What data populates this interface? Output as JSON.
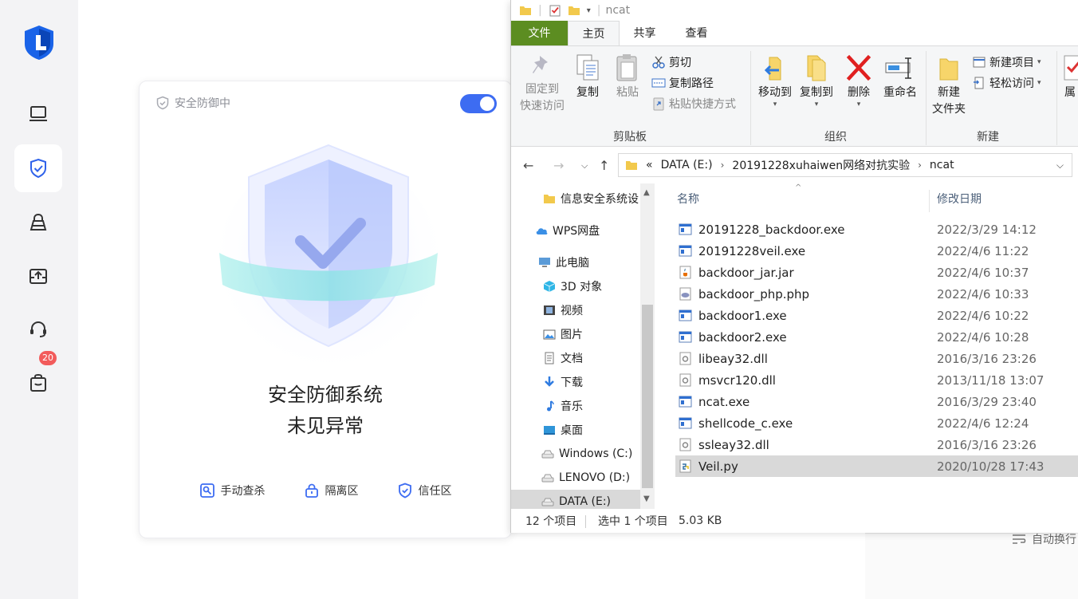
{
  "security_app": {
    "sidebar_badge": "20",
    "status_label": "安全防御中",
    "toggle_on": true,
    "title_line1": "安全防御系统",
    "title_line2": "未见异常",
    "actions": [
      "手动查杀",
      "隔离区",
      "信任区"
    ],
    "icons": [
      "logo-icon",
      "laptop-icon",
      "shield-check-icon",
      "lock-icon",
      "upload-drive-icon",
      "headset-icon",
      "bag-icon"
    ],
    "accent_color": "#3d6cf2",
    "badge_color": "#f25b5b"
  },
  "background_panel": {
    "partial_text": "自动换行"
  },
  "explorer": {
    "window_title": "ncat",
    "tabs": {
      "file": "文件",
      "home": "主页",
      "share": "共享",
      "view": "查看"
    },
    "ribbon": {
      "clipboard": {
        "pin": "固定到\n快速访问",
        "copy": "复制",
        "paste": "粘贴",
        "cut": "剪切",
        "copy_path": "复制路径",
        "paste_shortcut": "粘贴快捷方式",
        "label": "剪贴板"
      },
      "organize": {
        "move_to": "移动到",
        "copy_to": "复制到",
        "delete": "删除",
        "rename": "重命名",
        "label": "组织"
      },
      "new": {
        "new_folder": "新建\n文件夹",
        "new_item": "新建项目",
        "easy_access": "轻松访问",
        "label": "新建"
      },
      "open_partial": "属"
    },
    "address": {
      "prefix": "«",
      "parts": [
        "DATA (E:)",
        "20191228xuhaiwen网络对抗实验",
        "ncat"
      ]
    },
    "nav_items": [
      {
        "label": "信息安全系统设",
        "icon": "folder-icon"
      },
      {
        "label": "WPS网盘",
        "icon": "cloud-icon"
      },
      {
        "label": "此电脑",
        "icon": "computer-icon"
      },
      {
        "label": "3D 对象",
        "icon": "cube-icon"
      },
      {
        "label": "视频",
        "icon": "video-icon"
      },
      {
        "label": "图片",
        "icon": "picture-icon"
      },
      {
        "label": "文档",
        "icon": "document-icon"
      },
      {
        "label": "下载",
        "icon": "download-icon"
      },
      {
        "label": "音乐",
        "icon": "music-icon"
      },
      {
        "label": "桌面",
        "icon": "desktop-icon"
      },
      {
        "label": "Windows (C:)",
        "icon": "drive-icon"
      },
      {
        "label": "LENOVO (D:)",
        "icon": "drive-icon"
      },
      {
        "label": "DATA (E:)",
        "icon": "drive-icon"
      }
    ],
    "columns": {
      "name": "名称",
      "modified": "修改日期"
    },
    "files": [
      {
        "name": "20191228_backdoor.exe",
        "date": "2022/3/29 14:12",
        "type": "exe"
      },
      {
        "name": "20191228veil.exe",
        "date": "2022/4/6 11:22",
        "type": "exe"
      },
      {
        "name": "backdoor_jar.jar",
        "date": "2022/4/6 10:37",
        "type": "jar"
      },
      {
        "name": "backdoor_php.php",
        "date": "2022/4/6 10:33",
        "type": "php"
      },
      {
        "name": "backdoor1.exe",
        "date": "2022/4/6 10:22",
        "type": "exe"
      },
      {
        "name": "backdoor2.exe",
        "date": "2022/4/6 10:28",
        "type": "exe"
      },
      {
        "name": "libeay32.dll",
        "date": "2016/3/16 23:26",
        "type": "dll"
      },
      {
        "name": "msvcr120.dll",
        "date": "2013/11/18 13:07",
        "type": "dll"
      },
      {
        "name": "ncat.exe",
        "date": "2016/3/29 23:40",
        "type": "exe"
      },
      {
        "name": "shellcode_c.exe",
        "date": "2022/4/6 12:24",
        "type": "exe"
      },
      {
        "name": "ssleay32.dll",
        "date": "2016/3/16 23:26",
        "type": "dll"
      },
      {
        "name": "Veil.py",
        "date": "2020/10/28 17:43",
        "type": "py"
      }
    ],
    "status": {
      "count": "12 个项目",
      "selected": "选中 1 个项目",
      "size": "5.03 KB"
    }
  }
}
